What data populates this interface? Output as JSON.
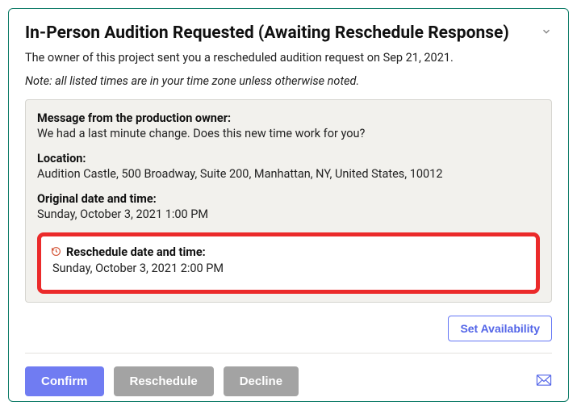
{
  "header": {
    "title": "In-Person Audition Requested (Awaiting Reschedule Response)"
  },
  "subtext": "The owner of this project sent you a rescheduled audition request on Sep 21, 2021.",
  "note": "Note: all listed times are in your time zone unless otherwise noted.",
  "details": {
    "message_label": "Message from the production owner:",
    "message_value": "We had a last minute change. Does this new time work for you?",
    "location_label": "Location:",
    "location_value": "Audition Castle, 500 Broadway, Suite 200, Manhattan, NY, United States, 10012",
    "original_label": "Original date and time:",
    "original_value": "Sunday, October 3, 2021 1:00 PM",
    "reschedule_label": "Reschedule date and time:",
    "reschedule_value": "Sunday, October 3, 2021 2:00 PM"
  },
  "buttons": {
    "set_availability": "Set Availability",
    "confirm": "Confirm",
    "reschedule": "Reschedule",
    "decline": "Decline"
  }
}
